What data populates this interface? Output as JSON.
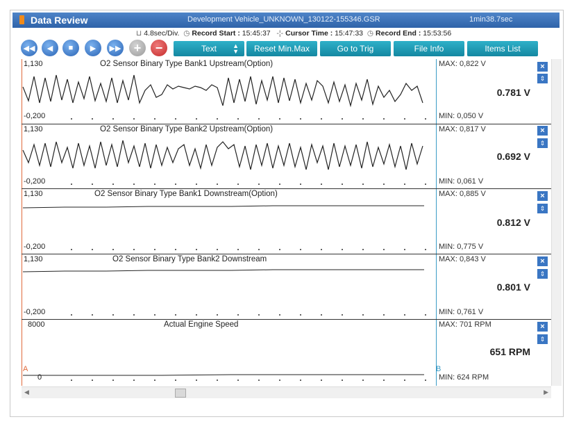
{
  "window": {
    "app_title": "Data Review",
    "file": "Development Vehicle_UNKNOWN_130122-155346.GSR",
    "duration": "1min38.7sec"
  },
  "info": {
    "div": "4.8sec/Div.",
    "record_start_label": "Record Start :",
    "record_start": "15:45:37",
    "cursor_time_label": "Cursor Time :",
    "cursor_time": "15:47:33",
    "record_end_label": "Record End :",
    "record_end": "15:53:56"
  },
  "toolbar": {
    "text_label": "Text",
    "reset_label": "Reset Min.Max",
    "goto_trig_label": "Go to Trig",
    "file_info_label": "File Info",
    "items_list_label": "Items List"
  },
  "icons": {
    "rewind": "fast-backward-icon",
    "back": "step-back-icon",
    "stop": "stop-icon",
    "play": "play-icon",
    "forward": "fast-forward-icon",
    "add": "plus-icon",
    "remove": "minus-icon"
  },
  "channels": [
    {
      "title": "O2 Sensor Binary Type Bank1 Upstream(Option)",
      "ymax": "1,130",
      "ymin": "-0,200",
      "max": "MAX: 0,822 V",
      "min": "MIN: 0,050 V",
      "current": "0.781 V"
    },
    {
      "title": "O2 Sensor Binary Type Bank2 Upstream(Option)",
      "ymax": "1,130",
      "ymin": "-0,200",
      "max": "MAX: 0,817 V",
      "min": "MIN: 0,061 V",
      "current": "0.692 V"
    },
    {
      "title": "O2 Sensor Binary Type Bank1 Downstream(Option)",
      "ymax": "1,130",
      "ymin": "-0,200",
      "max": "MAX: 0,885 V",
      "min": "MIN: 0,775 V",
      "current": "0.812 V"
    },
    {
      "title": "O2 Sensor Binary Type Bank2 Downstream",
      "ymax": "1,130",
      "ymin": "-0,200",
      "max": "MAX: 0,843 V",
      "min": "MIN: 0,761 V",
      "current": "0.801 V"
    },
    {
      "title": "Actual Engine Speed",
      "ymax": "8000",
      "ymin": "0",
      "max": "MAX:   701 RPM",
      "min": "MIN:   624 RPM",
      "current": "651 RPM"
    }
  ],
  "cursor_a": "A",
  "cursor_b": "B",
  "colors": {
    "titlebar": "#2f63a9",
    "button": "#1487a1",
    "cursor_a": "#e06a3b",
    "cursor_b": "#3a9bc6"
  }
}
